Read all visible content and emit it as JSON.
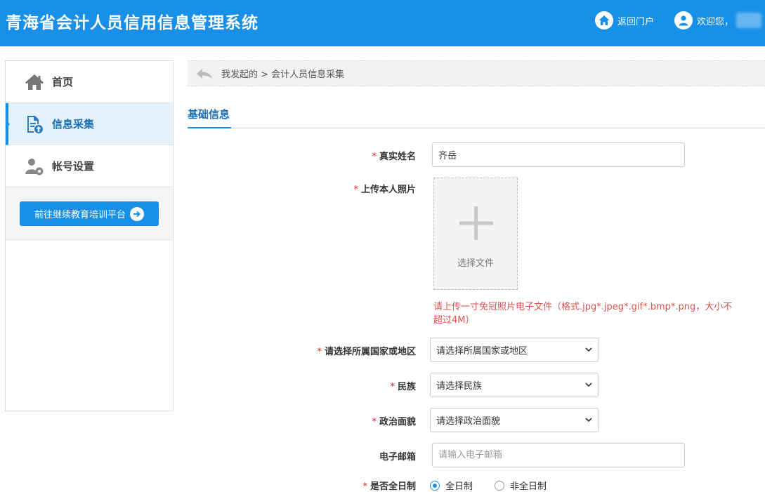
{
  "header": {
    "title": "青海省会计人员信用信息管理系统",
    "portal_label": "返回门户",
    "welcome_label": "欢迎您，"
  },
  "sidebar": {
    "items": [
      {
        "label": "首页",
        "icon": "home-icon"
      },
      {
        "label": "信息采集",
        "icon": "info-collect-icon",
        "active": true
      },
      {
        "label": "帐号设置",
        "icon": "account-settings-icon"
      }
    ],
    "training_button": "前往继续教育培训平台"
  },
  "breadcrumb": {
    "text": "我发起的 > 会计人员信息采集"
  },
  "tabs": {
    "basic_info": "基础信息"
  },
  "form": {
    "required_mark": "*",
    "real_name": {
      "label": "真实姓名",
      "value": "齐岳"
    },
    "photo": {
      "label": "上传本人照片",
      "upload_text": "选择文件",
      "hint": "请上传一寸免冠照片电子文件（格式.jpg*.jpeg*.gif*.bmp*.png，大小不超过4M）"
    },
    "country": {
      "label": "请选择所属国家或地区",
      "value": "请选择所属国家或地区"
    },
    "ethnicity": {
      "label": "民族",
      "value": "请选择民族"
    },
    "political": {
      "label": "政治面貌",
      "value": "请选择政治面貌"
    },
    "email": {
      "label": "电子邮箱",
      "placeholder": "请输入电子邮箱"
    },
    "fulltime": {
      "label": "是否全日制",
      "options": [
        "全日制",
        "非全日制"
      ],
      "selected": "全日制"
    }
  },
  "colors": {
    "header_bg": "#1890e8",
    "accent": "#1a6fb5",
    "required": "#e02020",
    "hint": "#d9534f"
  }
}
